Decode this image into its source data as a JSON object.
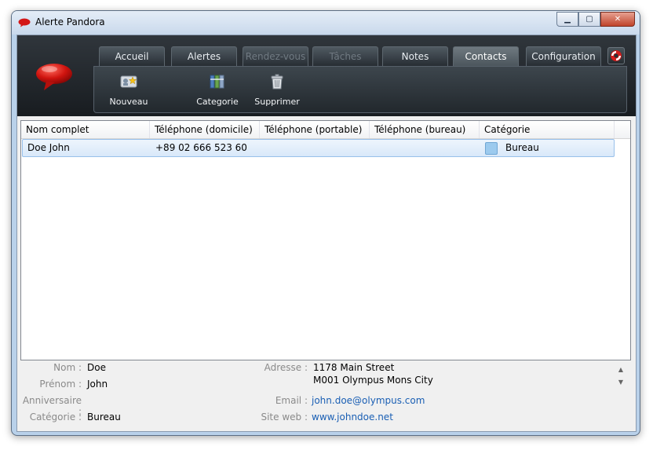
{
  "window": {
    "title": "Alerte Pandora"
  },
  "tabs": [
    {
      "label": "Accueil",
      "state": "normal"
    },
    {
      "label": "Alertes",
      "state": "normal"
    },
    {
      "label": "Rendez-vous",
      "state": "disabled"
    },
    {
      "label": "Tâches",
      "state": "disabled"
    },
    {
      "label": "Notes",
      "state": "normal"
    },
    {
      "label": "Contacts",
      "state": "active"
    },
    {
      "label": "Configuration",
      "state": "normal"
    }
  ],
  "toolbar": {
    "new_label": "Nouveau",
    "category_label": "Categorie",
    "delete_label": "Supprimer"
  },
  "table": {
    "columns": [
      "Nom complet",
      "Téléphone (domicile)",
      "Téléphone (portable)",
      "Téléphone (bureau)",
      "Catégorie"
    ],
    "rows": [
      {
        "name": "Doe John",
        "phone_home": "+89 02 666 523 60",
        "phone_mobile": "",
        "phone_office": "",
        "category": "Bureau"
      }
    ]
  },
  "details": {
    "nom_label": "Nom :",
    "nom": "Doe",
    "prenom_label": "Prénom :",
    "prenom": "John",
    "anniversaire_label": "Anniversaire :",
    "categorie_label": "Catégorie :",
    "categorie": "Bureau",
    "adresse_label": "Adresse :",
    "adresse_line1": "1178 Main Street",
    "adresse_line2": "M001 Olympus Mons City",
    "email_label": "Email :",
    "email": "john.doe@olympus.com",
    "site_label": "Site web :",
    "site": "www.johndoe.net"
  },
  "colors": {
    "accent_red": "#cc1111",
    "header_dark": "#1c2024",
    "selection": "#d9e8f9",
    "category_bureau": "#9ccaee",
    "link": "#1a5fb4"
  }
}
